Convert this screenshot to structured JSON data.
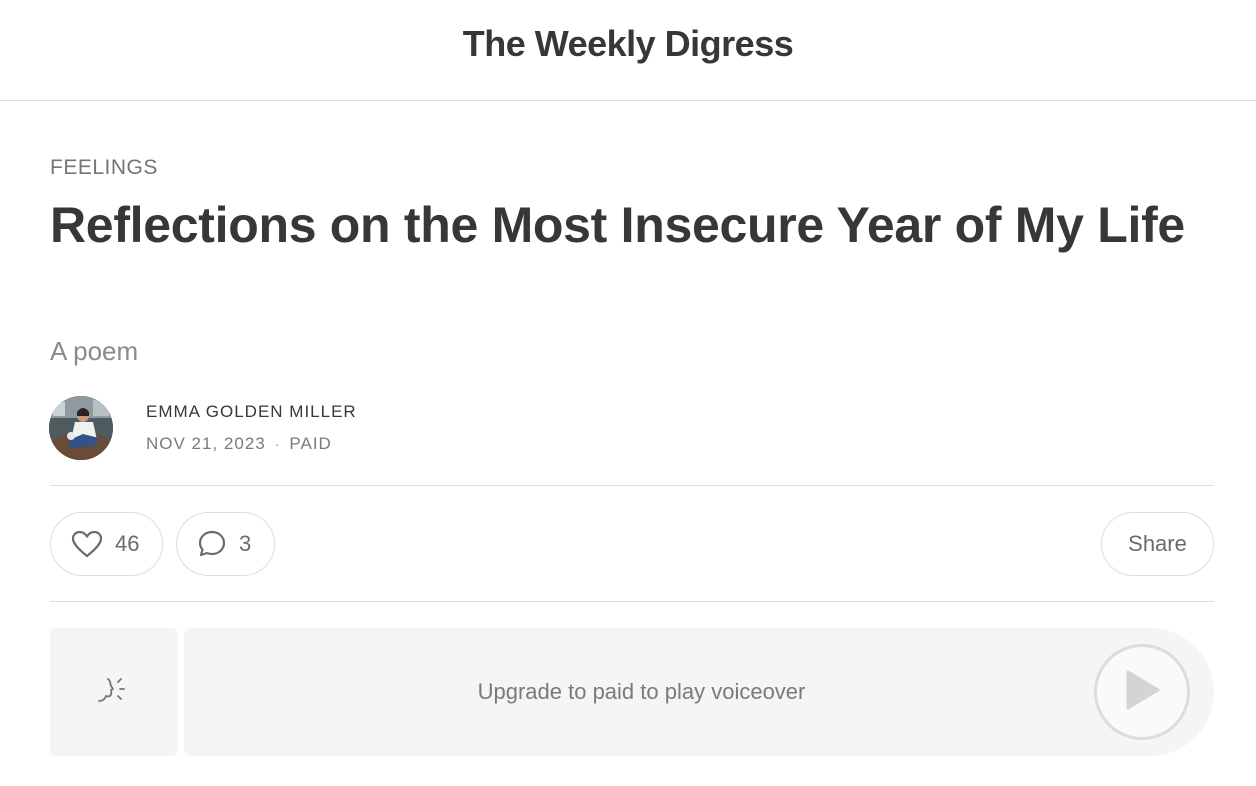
{
  "header": {
    "publication_name": "The Weekly Digress"
  },
  "article": {
    "section": "FEELINGS",
    "title": "Reflections on the Most Insecure Year of My Life",
    "subtitle": "A poem",
    "author": "EMMA GOLDEN MILLER",
    "date": "NOV 21, 2023",
    "separator": "·",
    "access": "PAID"
  },
  "actions": {
    "likes_count": "46",
    "comments_count": "3",
    "share_label": "Share",
    "icons": {
      "like": "heart-icon",
      "comment": "comment-bubble-icon"
    }
  },
  "voiceover": {
    "message": "Upgrade to paid to play voiceover",
    "icons": {
      "voice": "speaking-head-icon",
      "play": "play-icon"
    }
  }
}
